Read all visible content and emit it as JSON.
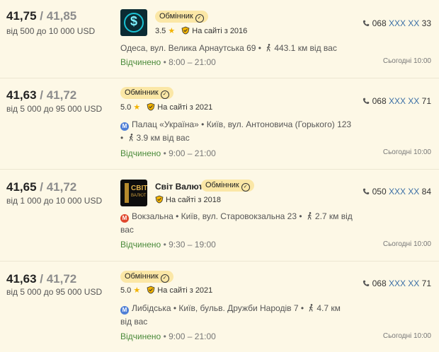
{
  "offers": [
    {
      "buy": "41,75",
      "sep": " / ",
      "sell": "41,85",
      "range": "від 500 до 10 000 USD",
      "logo": "dollar-logo",
      "name": "",
      "type": "Обмінник",
      "rating": "3.5",
      "since": "На сайті з 2016",
      "metro": null,
      "address": "Одеса, вул. Велика Арнаутська 69 •",
      "distance": "443.1 км від вас",
      "status": "Відчинено",
      "hours": " • 8:00 – 21:00",
      "phone_prefix": "068 ",
      "phone_mask": "XXX XX",
      "phone_suffix": " 33",
      "today": "Сьогодні 10:00"
    },
    {
      "buy": "41,63",
      "sep": " / ",
      "sell": "41,72",
      "range": "від 5 000 до 95 000 USD",
      "logo": null,
      "name": "",
      "type": "Обмінник",
      "rating": "5.0",
      "since": "На сайті з 2021",
      "metro": {
        "letter": "M",
        "color": "#4f7fd6"
      },
      "address": "Палац «Україна» • Київ, вул. Антоновича (Горького) 123 •",
      "distance": "3.9 км від вас",
      "status": "Відчинено",
      "hours": " • 9:00 – 21:00",
      "phone_prefix": "068 ",
      "phone_mask": "XXX XX",
      "phone_suffix": " 71",
      "today": "Сьогодні 10:00"
    },
    {
      "buy": "41,65",
      "sep": " / ",
      "sell": "41,72",
      "range": "від 1 000 до 10 000 USD",
      "logo": "svit-logo",
      "logo_text": "СВІТ",
      "logo_sub": "ВАЛЮТ",
      "name": "Світ Валют",
      "type": "Обмінник",
      "rating": "",
      "since": "На сайті з 2018",
      "metro": {
        "letter": "M",
        "color": "#e0482e"
      },
      "address": "Вокзальна • Київ, вул. Старовокзальна 23 •",
      "distance": "2.7 км від вас",
      "status": "Відчинено",
      "hours": " • 9:30 – 19:00",
      "phone_prefix": "050 ",
      "phone_mask": "XXX XX",
      "phone_suffix": " 84",
      "today": "Сьогодні 10:00"
    },
    {
      "buy": "41,63",
      "sep": " / ",
      "sell": "41,72",
      "range": "від 5 000 до 95 000 USD",
      "logo": null,
      "name": "",
      "type": "Обмінник",
      "rating": "5.0",
      "since": "На сайті з 2021",
      "metro": {
        "letter": "M",
        "color": "#4f7fd6"
      },
      "address": "Либідська • Київ, бульв. Дружби Народів 7 •",
      "distance": "4.7 км від вас",
      "status": "Відчинено",
      "hours": " • 9:00 – 21:00",
      "phone_prefix": "068 ",
      "phone_mask": "XXX XX",
      "phone_suffix": " 71",
      "today": "Сьогодні 10:00"
    }
  ],
  "colors": {
    "background": "#fdf8e6",
    "badge": "#fbe7a6",
    "open_status": "#4a8a3a",
    "phone_mask": "#3a6ea5",
    "star": "#f2b300"
  },
  "icons": {
    "check": "✓",
    "star": "★"
  }
}
